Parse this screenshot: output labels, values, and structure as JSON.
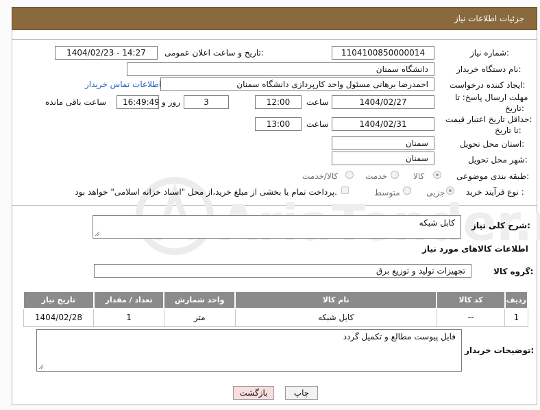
{
  "title": "جزئیات اطلاعات نیاز",
  "form": {
    "need_number_label": "شماره نیاز:",
    "need_number": "1104100850000014",
    "announce_label": "تاریخ و ساعت اعلان عمومی:",
    "announce_value": "1404/02/23 - 14:27",
    "buyer_org_label": "نام دستگاه خریدار:",
    "buyer_org": "دانشگاه سمنان",
    "creator_label": "ایجاد کننده درخواست:",
    "creator": "احمدرضا برهانی مسئول واحد کارپردازی دانشگاه سمنان",
    "contact_link": "اطلاعات تماس خریدار",
    "deadline_label_1": "مهلت ارسال پاسخ: تا",
    "deadline_label_2": "تاریخ:",
    "deadline_date": "1404/02/27",
    "hour_label": "ساعت",
    "deadline_time": "12:00",
    "days_count": "3",
    "days_label": "روز و",
    "remaining_time": "16:49:49",
    "remaining_label": "ساعت باقی مانده",
    "price_validity_label_1": "حداقل تاریخ اعتبار قیمت:",
    "price_validity_label_2": "تا تاریخ:",
    "price_validity_date": "1404/02/31",
    "price_validity_time": "13:00",
    "province_label": "استان محل تحویل:",
    "province": "سمنان",
    "city_label": "شهر محل تحویل:",
    "city": "سمنان",
    "category_label": "طبقه بندی موضوعی:",
    "category_options": [
      "کالا",
      "خدمت",
      "کالا/خدمت"
    ],
    "category_selected": "کالا",
    "process_label": "نوع فرآیند خرید :",
    "process_options": [
      "جزیی",
      "متوسط"
    ],
    "process_selected": "جزیی",
    "payment_note": "پرداخت تمام یا بخشی از مبلغ خرید،از محل \"اسناد خزانه اسلامی\" خواهد بود."
  },
  "description": {
    "label": "شرح کلی نیاز:",
    "value": "کابل شبکه"
  },
  "goods_section_title": "اطلاعات کالاهای مورد نیاز",
  "goods_group": {
    "label": "گروه کالا:",
    "value": "تجهیزات تولید و توزیع برق"
  },
  "table": {
    "headers": [
      "ردیف",
      "کد کالا",
      "نام کالا",
      "واحد شمارش",
      "تعداد / مقدار",
      "تاریخ نیاز"
    ],
    "rows": [
      [
        "1",
        "--",
        "کابل شبکه",
        "متر",
        "1",
        "1404/02/28"
      ]
    ]
  },
  "buyer_notes": {
    "label": "توضیحات خریدار:",
    "value": "فایل پیوست مطالع و تکمیل گردد"
  },
  "buttons": {
    "print": "چاپ",
    "back": "بازگشت"
  },
  "watermark": "AriaTender.neT",
  "colors": {
    "title_bar": "#8a6a3c",
    "table_header": "#8b8b8b",
    "back_button": "#f9dede",
    "link": "#1a5fc4"
  }
}
